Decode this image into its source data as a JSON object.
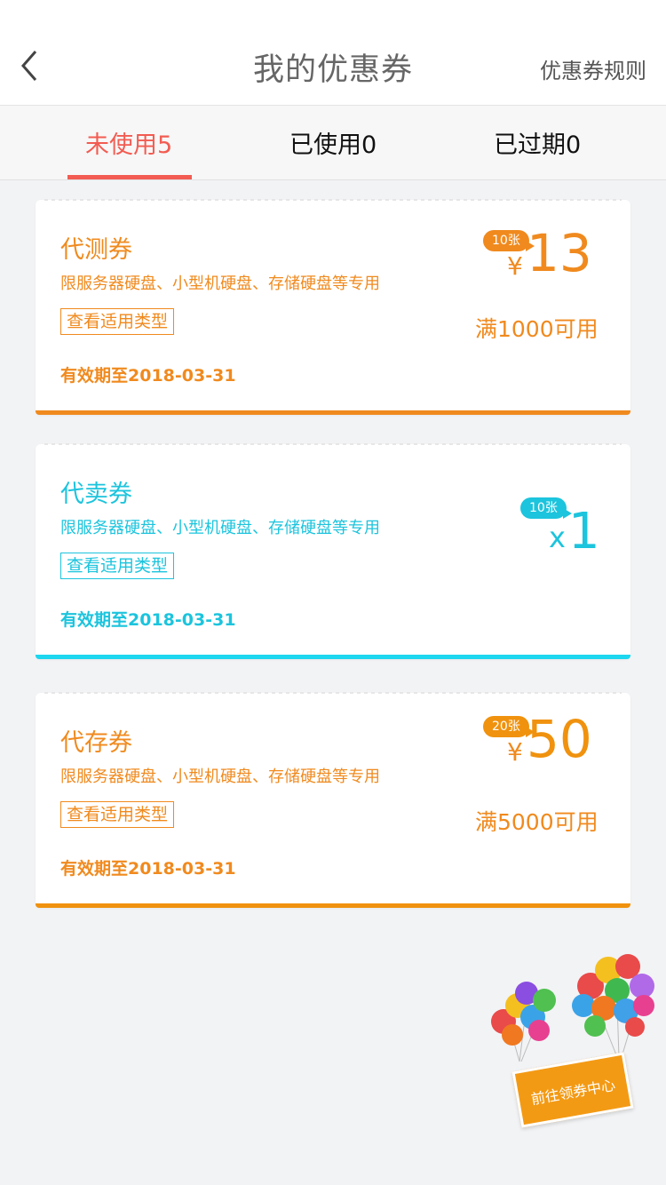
{
  "header": {
    "title": "我的优惠券",
    "rules_label": "优惠券规则"
  },
  "tabs": [
    {
      "label": "未使用5",
      "active": true
    },
    {
      "label": "已使用0",
      "active": false
    },
    {
      "label": "已过期0",
      "active": false
    }
  ],
  "coupons": [
    {
      "name": "代测券",
      "desc": "限服务器硬盘、小型机硬盘、存储硬盘等专用",
      "type_button": "查看适用类型",
      "valid": "有效期至2018-03-31",
      "badge": "10张",
      "currency": "¥",
      "amount": "13",
      "condition": "满1000可用",
      "color": "#f08a1e"
    },
    {
      "name": "代卖券",
      "desc": "限服务器硬盘、小型机硬盘、存储硬盘等专用",
      "type_button": "查看适用类型",
      "valid": "有效期至2018-03-31",
      "badge": "10张",
      "multiplier": "x",
      "amount": "1",
      "color": "#1cc4dd"
    },
    {
      "name": "代存券",
      "desc": "限服务器硬盘、小型机硬盘、存储硬盘等专用",
      "type_button": "查看适用类型",
      "valid": "有效期至2018-03-31",
      "badge": "20张",
      "currency": "¥",
      "amount": "50",
      "condition": "满5000可用",
      "color": "#f0920e"
    }
  ],
  "promo": {
    "label": "前往领券中心"
  }
}
